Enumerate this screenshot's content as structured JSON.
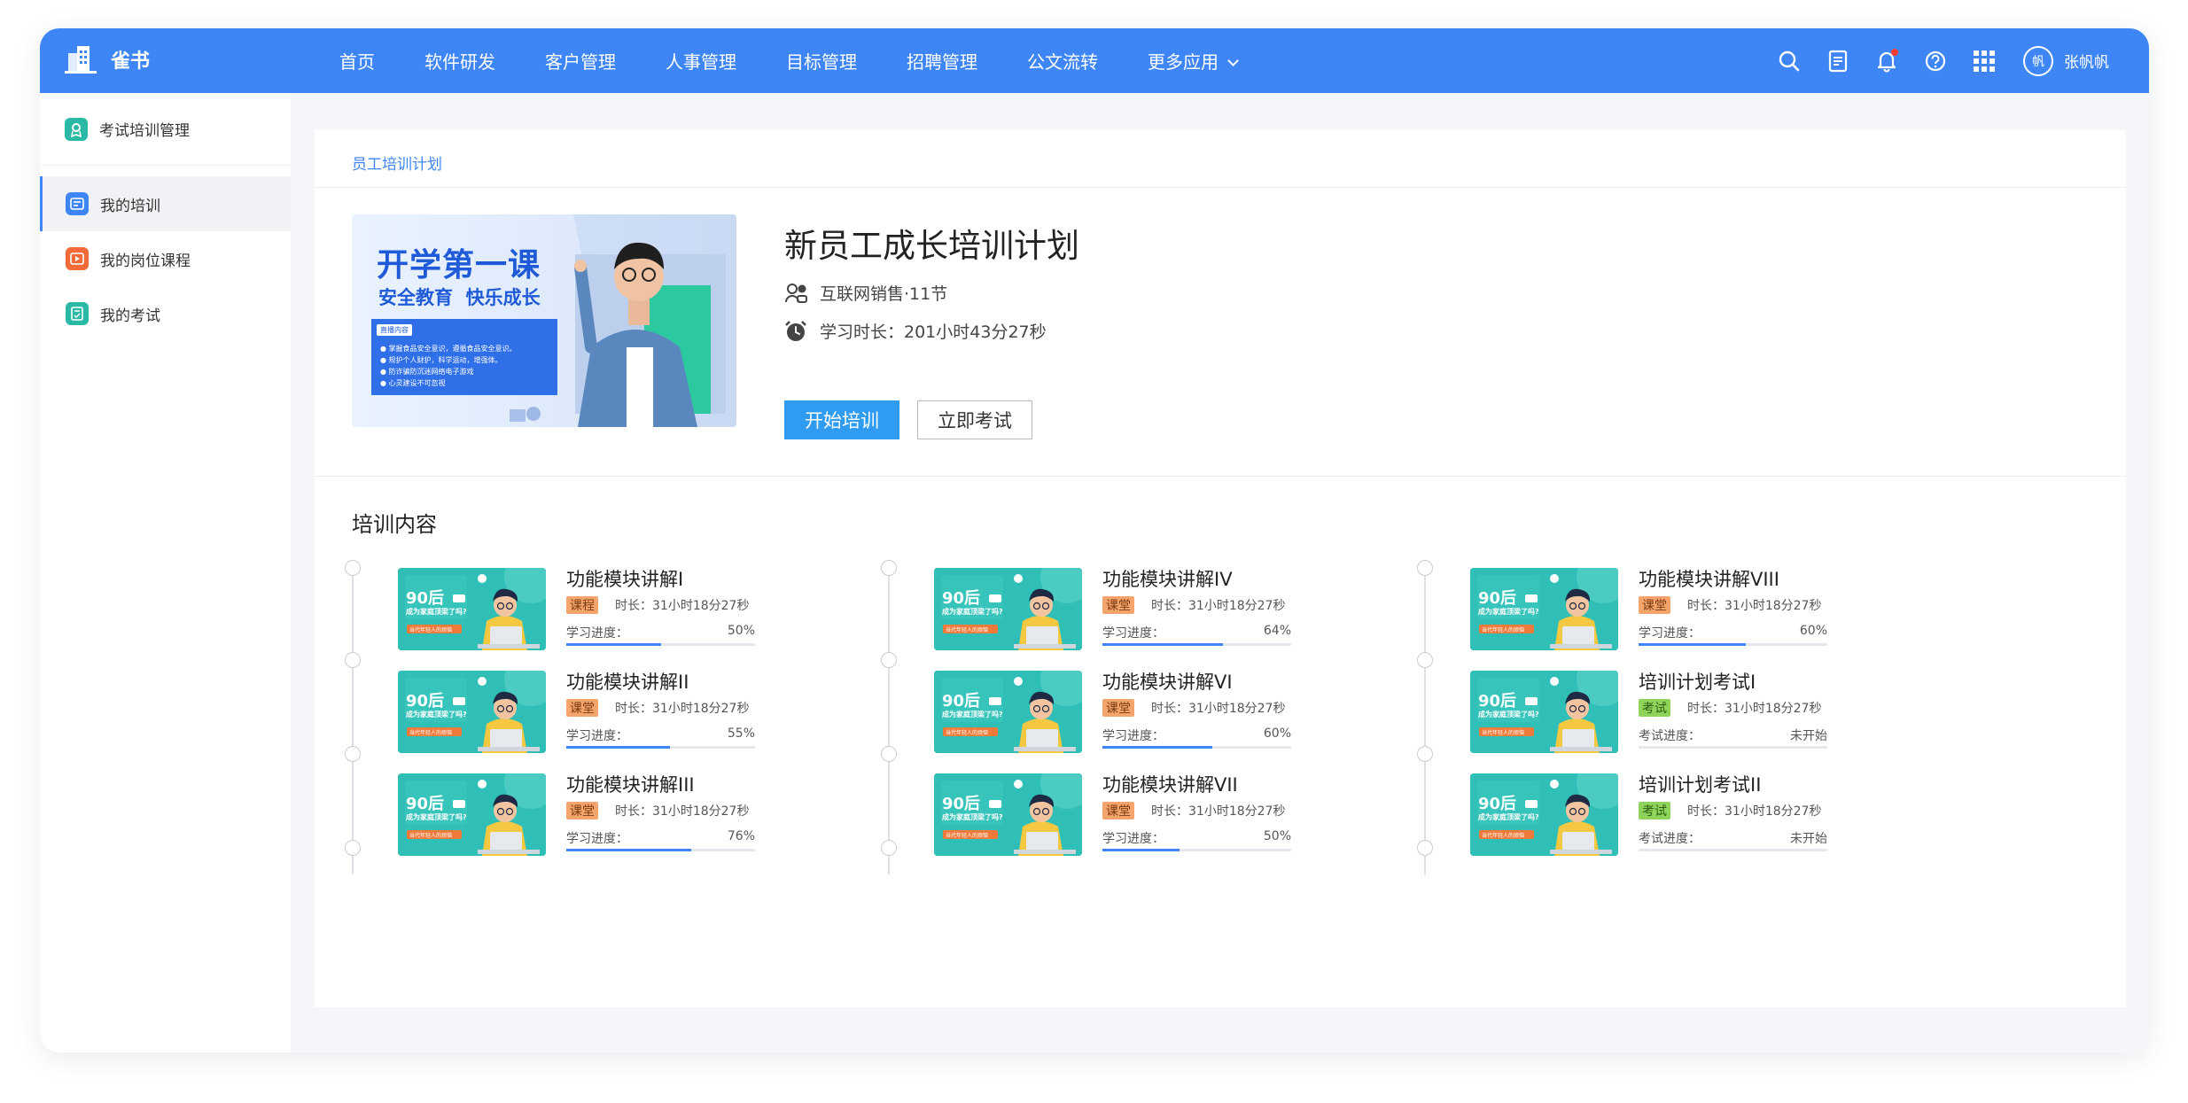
{
  "app": {
    "name": "雀书"
  },
  "nav": {
    "items": [
      "首页",
      "软件研发",
      "客户管理",
      "人事管理",
      "目标管理",
      "招聘管理",
      "公文流转"
    ],
    "more": "更多应用"
  },
  "user": {
    "avatar_text": "帆",
    "name": "张帆帆"
  },
  "icons": [
    "building-logo-icon",
    "search-icon",
    "document-icon",
    "bell-icon",
    "help-icon",
    "apps-grid-icon",
    "chevron-down-icon"
  ],
  "sidebar": {
    "header": "考试培训管理",
    "items": [
      {
        "label": "我的培训",
        "active": true,
        "color": "#3e86f6"
      },
      {
        "label": "我的岗位课程",
        "active": false,
        "color": "#f06a3a"
      },
      {
        "label": "我的考试",
        "active": false,
        "color": "#29b9a4"
      }
    ]
  },
  "breadcrumb": "员工培训计划",
  "plan": {
    "title": "新员工成长培训计划",
    "category": "互联网销售·11节",
    "study_time": "学习时长：201小时43分27秒",
    "start_button": "开始培训",
    "exam_button": "立即考试",
    "banner": {
      "headline": "开学第一课",
      "subline": "安全教育  快乐成长",
      "box_title": "直播内容",
      "points": [
        "掌握食品安全意识，遵循食品安全意识。",
        "规护个人财护，科学运动，增强体。",
        "防诈骗防沉迷网络电子游戏",
        "心灵建设不可忽视"
      ]
    }
  },
  "content": {
    "title": "培训内容",
    "thumb": {
      "big": "90后",
      "line": "成为家庭顶梁了吗?",
      "sub": "当代年轻人的烦恼"
    },
    "columns": [
      [
        {
          "title": "功能模块讲解I",
          "tag": "课程",
          "type": "course",
          "duration": "时长：31小时18分27秒",
          "progress_label": "学习进度：",
          "progress_text": "50%",
          "progress": 0.5
        },
        {
          "title": "功能模块讲解II",
          "tag": "课堂",
          "type": "course",
          "duration": "时长：31小时18分27秒",
          "progress_label": "学习进度：",
          "progress_text": "55%",
          "progress": 0.55
        },
        {
          "title": "功能模块讲解III",
          "tag": "课堂",
          "type": "course",
          "duration": "时长：31小时18分27秒",
          "progress_label": "学习进度：",
          "progress_text": "76%",
          "progress": 0.66
        }
      ],
      [
        {
          "title": "功能模块讲解IV",
          "tag": "课堂",
          "type": "course",
          "duration": "时长：31小时18分27秒",
          "progress_label": "学习进度：",
          "progress_text": "64%",
          "progress": 0.64
        },
        {
          "title": "功能模块讲解VI",
          "tag": "课堂",
          "type": "course",
          "duration": "时长：31小时18分27秒",
          "progress_label": "学习进度：",
          "progress_text": "60%",
          "progress": 0.58
        },
        {
          "title": "功能模块讲解VII",
          "tag": "课堂",
          "type": "course",
          "duration": "时长：31小时18分27秒",
          "progress_label": "学习进度：",
          "progress_text": "50%",
          "progress": 0.41
        }
      ],
      [
        {
          "title": "功能模块讲解VIII",
          "tag": "课堂",
          "type": "course",
          "duration": "时长：31小时18分27秒",
          "progress_label": "学习进度：",
          "progress_text": "60%",
          "progress": 0.57
        },
        {
          "title": "培训计划考试I",
          "tag": "考试",
          "type": "exam",
          "duration": "时长：31小时18分27秒",
          "progress_label": "考试进度：",
          "progress_text": "未开始",
          "progress": 0
        },
        {
          "title": "培训计划考试II",
          "tag": "考试",
          "type": "exam",
          "duration": "时长：31小时18分27秒",
          "progress_label": "考试进度：",
          "progress_text": "未开始",
          "progress": 0
        }
      ]
    ]
  }
}
